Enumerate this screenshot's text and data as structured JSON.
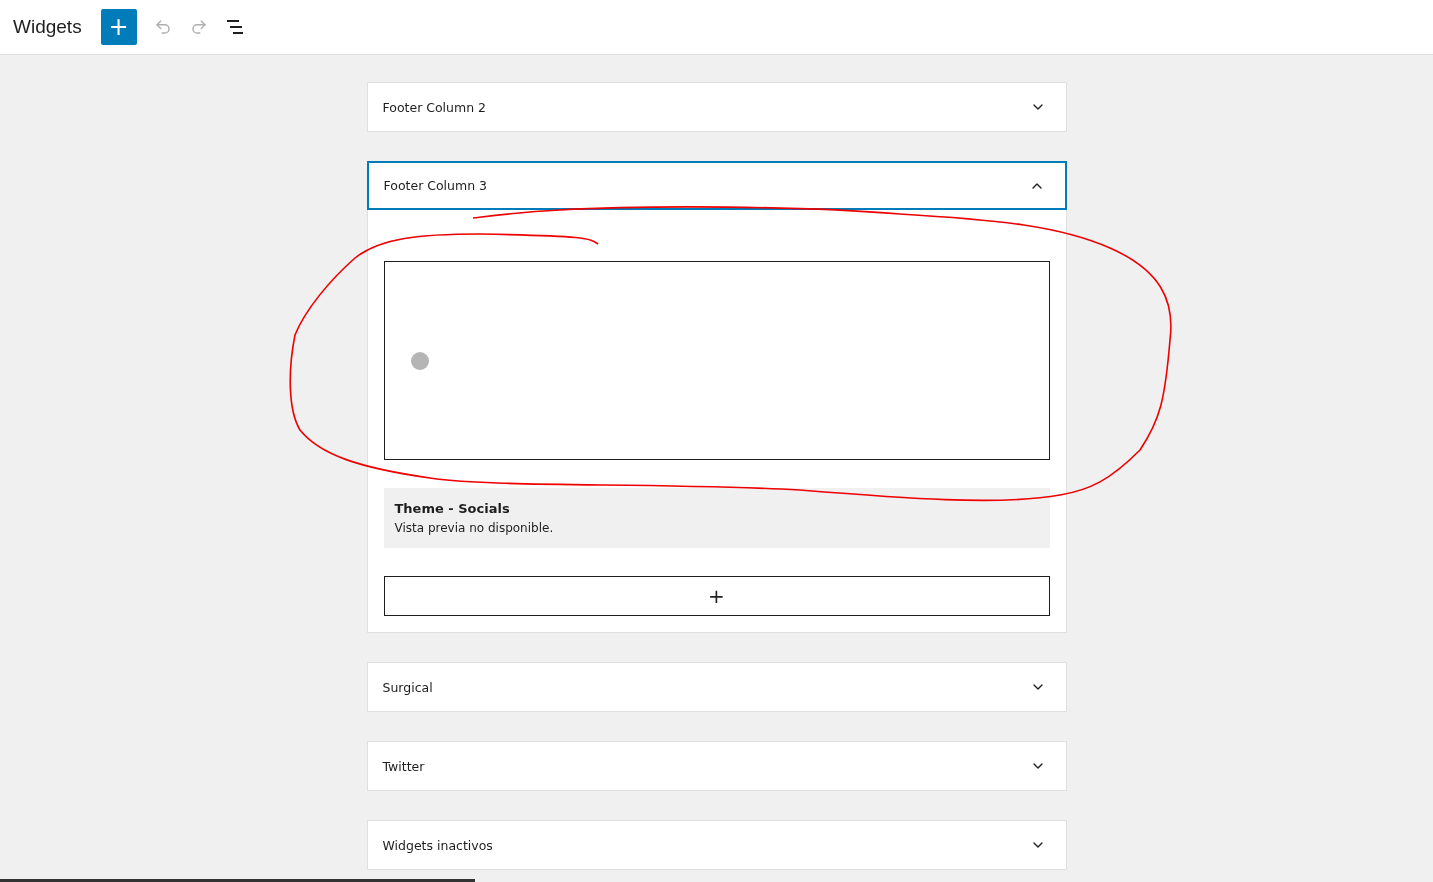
{
  "toolbar": {
    "title": "Widgets",
    "add_button": "+"
  },
  "areas": [
    {
      "title": "Footer Column 2",
      "expanded": false
    },
    {
      "title": "Footer Column 3",
      "expanded": true,
      "widget": {
        "title": "Theme - Socials",
        "message": "Vista previa no disponible."
      },
      "appender": "+"
    },
    {
      "title": "Surgical",
      "expanded": false
    },
    {
      "title": "Twitter",
      "expanded": false
    },
    {
      "title": "Widgets inactivos",
      "expanded": false
    }
  ]
}
